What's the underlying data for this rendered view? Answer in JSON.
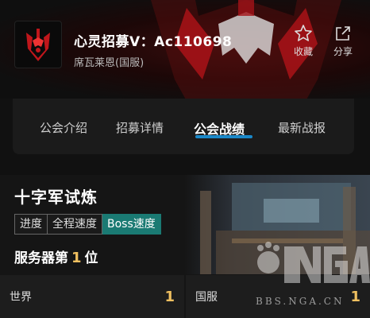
{
  "guild": {
    "title": "心灵招募V：Ac110698",
    "realm": "席瓦莱恩(国服)"
  },
  "actions": [
    {
      "label": "收藏",
      "icon": "star-icon"
    },
    {
      "label": "分享",
      "icon": "share-icon"
    }
  ],
  "tabs": [
    {
      "label": "公会介绍",
      "active": false
    },
    {
      "label": "招募详情",
      "active": false
    },
    {
      "label": "公会战绩",
      "active": true
    },
    {
      "label": "最新战报",
      "active": false
    }
  ],
  "raid": {
    "name": "十字军试炼",
    "filters": [
      {
        "label": "进度",
        "active": false
      },
      {
        "label": "全程速度",
        "active": false
      },
      {
        "label": "Boss速度",
        "active": true
      }
    ],
    "server_rank_prefix": "服务器第",
    "server_rank": "1",
    "server_rank_suffix": "位"
  },
  "rankings": [
    {
      "label": "世界",
      "value": "1"
    },
    {
      "label": "国服",
      "value": "1"
    }
  ],
  "watermark": {
    "text": "BBS.NGA.CN",
    "logo": "NGA"
  },
  "colors": {
    "accent": "#1a88c9",
    "filter_active": "#1a7a73",
    "rank_gold": "#f0c060",
    "horde_red": "#c0161b"
  }
}
